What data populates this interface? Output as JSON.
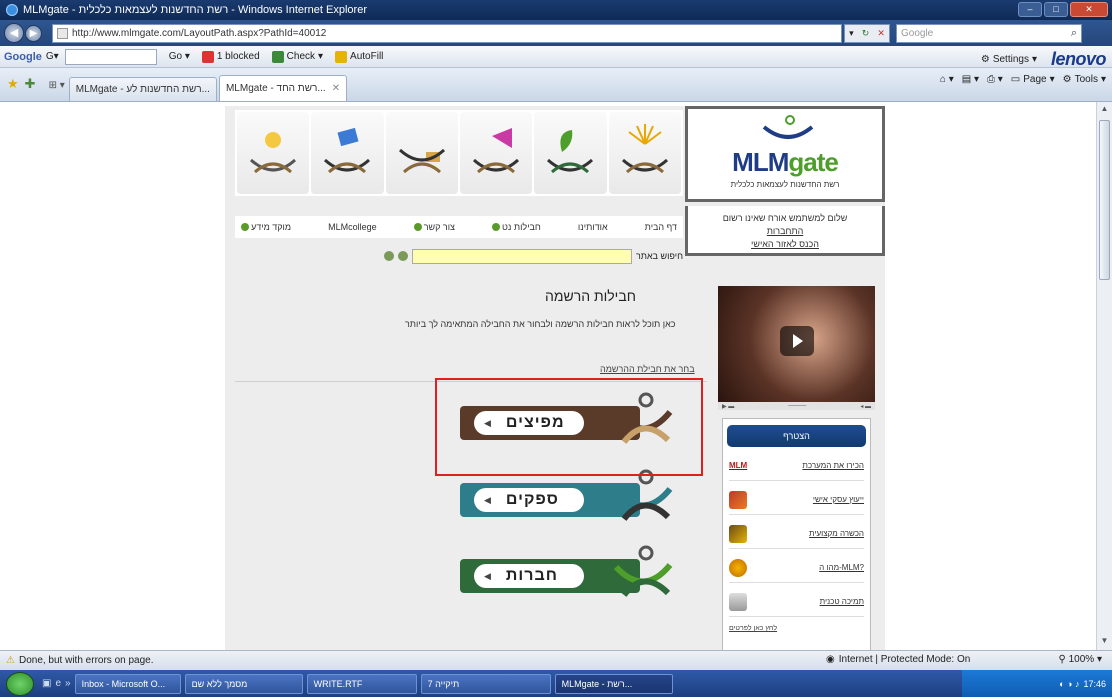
{
  "browser": {
    "title": "MLMgate - רשת החדשנות לעצמאות כלכלית - Windows Internet Explorer",
    "url": "http://www.mlmgate.com/LayoutPath.aspx?PathId=40012",
    "search_placeholder": "Google",
    "google_toolbar": {
      "logo": "Google",
      "blocked_label": "1 blocked",
      "check_label": "Check",
      "autofill_label": "AutoFill",
      "settings_label": "Settings",
      "brand": "lenovo"
    },
    "tabs": [
      {
        "label": "MLMgate - רשת החדשנות לע..."
      },
      {
        "label": "MLMgate - רשת החד..."
      }
    ],
    "commands": {
      "page": "Page",
      "tools": "Tools"
    }
  },
  "site": {
    "logo_text_a": "MLM",
    "logo_text_b": "gate",
    "logo_tagline": "רשת החדשנות לעצמאות כלכלית",
    "menu": [
      {
        "label": "דף הבית"
      },
      {
        "label": "אודותינו"
      },
      {
        "label": "חבילות נט"
      },
      {
        "label": "צור קשר"
      },
      {
        "label": "MLMcollege"
      },
      {
        "label": "מוקד מידע"
      }
    ],
    "login_info": {
      "line1": "שלום למשתמש אורח שאינו רשום",
      "line2": "התחברות",
      "line3": "הכנס לאזור האישי"
    },
    "search_label": "חיפוש באתר",
    "registration_title": "חבילות הרשמה",
    "registration_subtitle": "כאן תוכל לראות חבילות הרשמה ולבחור את החבילה המתאימה לך ביותר",
    "registration_link": "בחר את חבילת ההרשמה",
    "packages": [
      {
        "label": "מפיצים",
        "color": "#5a3a28"
      },
      {
        "label": "ספקים",
        "color": "#2d7d8a"
      },
      {
        "label": "חברות",
        "color": "#2e6a3a"
      }
    ],
    "sidemenu": {
      "header": "הצטרף",
      "items": [
        {
          "label": "הכירו את המערכת",
          "badge": "MLM"
        },
        {
          "label": "ייעוץ עסקי אישי"
        },
        {
          "label": "הכשרה מקצועית"
        },
        {
          "label": "מהו ה-MLM?"
        },
        {
          "label": "תמיכה טכנית"
        }
      ],
      "footer": "לחץ כאן לפרטים"
    }
  },
  "status": {
    "left": "Done, but with errors on page.",
    "zone": "Internet | Protected Mode: On",
    "zoom": "100%"
  },
  "taskbar": {
    "tasks": [
      {
        "label": "Inbox - Microsoft O..."
      },
      {
        "label": "מסמך ללא שם"
      },
      {
        "label": "WRITE.RTF"
      },
      {
        "label": "תיקייה 7"
      },
      {
        "label": "MLMgate - רשת..."
      }
    ],
    "clock": "17:46"
  }
}
